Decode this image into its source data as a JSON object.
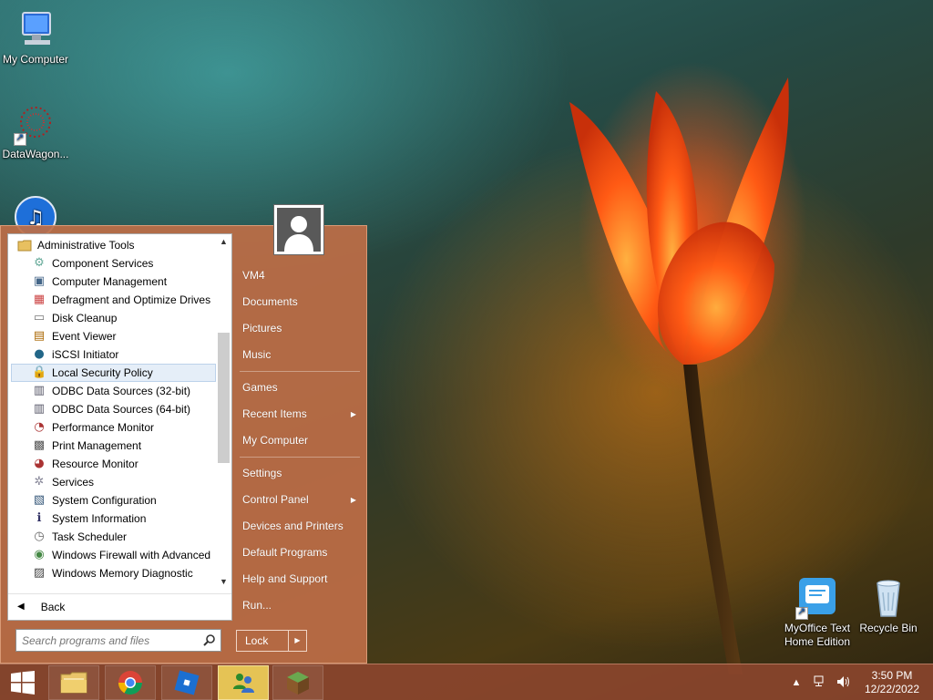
{
  "desktop": {
    "icons": [
      {
        "label": "My Computer",
        "icon": "computer-icon"
      },
      {
        "label": "DataWagon...",
        "icon": "datawagon-icon"
      },
      {
        "label": "MyOffice Text Home Edition",
        "line1": "MyOffice Text",
        "line2": "Home Edition",
        "icon": "myoffice-icon"
      },
      {
        "label": "Recycle Bin",
        "icon": "recycle-bin-icon"
      }
    ]
  },
  "start_menu": {
    "programs": {
      "folder": "Administrative Tools",
      "items": [
        {
          "label": "Component Services",
          "icon": "component-services-icon"
        },
        {
          "label": "Computer Management",
          "icon": "computer-management-icon"
        },
        {
          "label": "Defragment and Optimize Drives",
          "icon": "defragment-icon"
        },
        {
          "label": "Disk Cleanup",
          "icon": "disk-cleanup-icon"
        },
        {
          "label": "Event Viewer",
          "icon": "event-viewer-icon"
        },
        {
          "label": "iSCSI Initiator",
          "icon": "iscsi-icon"
        },
        {
          "label": "Local Security Policy",
          "icon": "security-policy-icon",
          "selected": true
        },
        {
          "label": "ODBC Data Sources (32-bit)",
          "icon": "odbc-icon"
        },
        {
          "label": "ODBC Data Sources (64-bit)",
          "icon": "odbc-icon"
        },
        {
          "label": "Performance Monitor",
          "icon": "performance-monitor-icon"
        },
        {
          "label": "Print Management",
          "icon": "print-management-icon"
        },
        {
          "label": "Resource Monitor",
          "icon": "resource-monitor-icon"
        },
        {
          "label": "Services",
          "icon": "services-icon"
        },
        {
          "label": "System Configuration",
          "icon": "system-configuration-icon"
        },
        {
          "label": "System Information",
          "icon": "system-information-icon"
        },
        {
          "label": "Task Scheduler",
          "icon": "task-scheduler-icon"
        },
        {
          "label": "Windows Firewall with Advanced",
          "icon": "firewall-icon"
        },
        {
          "label": "Windows Memory Diagnostic",
          "icon": "memory-diagnostic-icon"
        }
      ]
    },
    "back_label": "Back",
    "search_placeholder": "Search programs and files",
    "right_pane": {
      "group1": [
        {
          "label": "VM4"
        },
        {
          "label": "Documents"
        },
        {
          "label": "Pictures"
        },
        {
          "label": "Music"
        }
      ],
      "group2": [
        {
          "label": "Games"
        },
        {
          "label": "Recent Items",
          "submenu": true
        },
        {
          "label": "My Computer"
        }
      ],
      "group3": [
        {
          "label": "Settings"
        },
        {
          "label": "Control Panel",
          "submenu": true
        },
        {
          "label": "Devices and Printers"
        },
        {
          "label": "Default Programs"
        },
        {
          "label": "Help and Support"
        },
        {
          "label": "Run..."
        }
      ]
    },
    "lock_label": "Lock"
  },
  "taskbar": {
    "pinned": [
      {
        "name": "file-explorer",
        "icon": "folder-icon"
      },
      {
        "name": "chrome",
        "icon": "chrome-icon"
      },
      {
        "name": "roblox",
        "icon": "roblox-icon"
      },
      {
        "name": "people",
        "icon": "people-icon",
        "active": true
      },
      {
        "name": "minecraft",
        "icon": "minecraft-icon"
      }
    ],
    "clock": {
      "time": "3:50 PM",
      "date": "12/22/2022"
    }
  },
  "colors": {
    "start_menu_bg": "#be6e46",
    "selected_item_bg": "#e5eef8",
    "taskbar_bg": "#8c462d"
  }
}
